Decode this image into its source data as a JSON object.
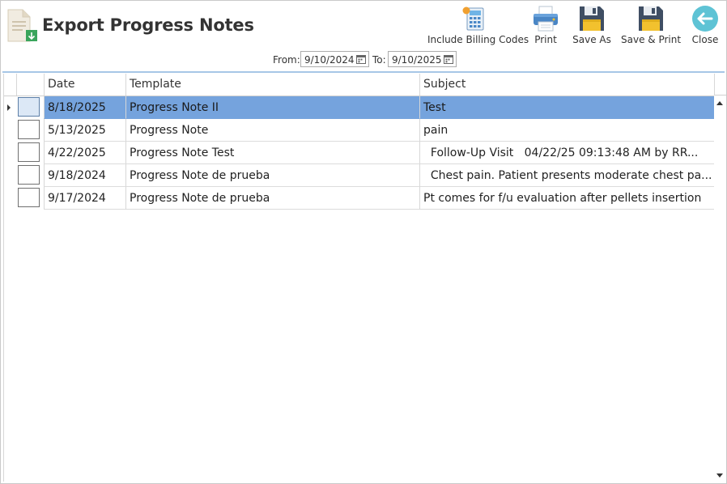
{
  "header": {
    "title": "Export Progress Notes"
  },
  "toolbar": {
    "billing_label": "Include Billing Codes",
    "print_label": "Print",
    "saveas_label": "Save As",
    "saveprint_label": "Save & Print",
    "close_label": "Close"
  },
  "daterange": {
    "from_label": "From:",
    "from_value": "9/10/2024",
    "to_label": "To:",
    "to_value": "9/10/2025"
  },
  "table": {
    "columns": [
      "Date",
      "Template",
      "Subject"
    ],
    "rows": [
      {
        "date": "8/18/2025",
        "template": "Progress Note II",
        "subject": "Test",
        "selected": true,
        "checked": false
      },
      {
        "date": "5/13/2025",
        "template": "Progress Note",
        "subject": "pain",
        "selected": false,
        "checked": false
      },
      {
        "date": "4/22/2025",
        "template": "Progress Note Test",
        "subject": "  Follow-Up Visit   04/22/25 09:13:48 AM by RR...",
        "selected": false,
        "checked": false
      },
      {
        "date": "9/18/2024",
        "template": "Progress Note de prueba",
        "subject": "  Chest pain. Patient presents moderate chest pa...",
        "selected": false,
        "checked": false
      },
      {
        "date": "9/17/2024",
        "template": "Progress Note de prueba",
        "subject": "Pt comes for f/u evaluation after pellets insertion",
        "selected": false,
        "checked": false
      }
    ]
  },
  "colors": {
    "selection": "#75a3dd",
    "separator": "#a7c6e6",
    "close_accent": "#5ec3d5",
    "save_dark": "#3f4e63",
    "save_yellow": "#f2c12e"
  },
  "icons": {
    "document": "document-export-icon",
    "billing": "calculator-icon",
    "print": "printer-icon",
    "saveas": "floppy-disk-icon",
    "saveprint": "floppy-disk-icon",
    "close": "back-arrow-icon",
    "calendar": "calendar-icon"
  }
}
